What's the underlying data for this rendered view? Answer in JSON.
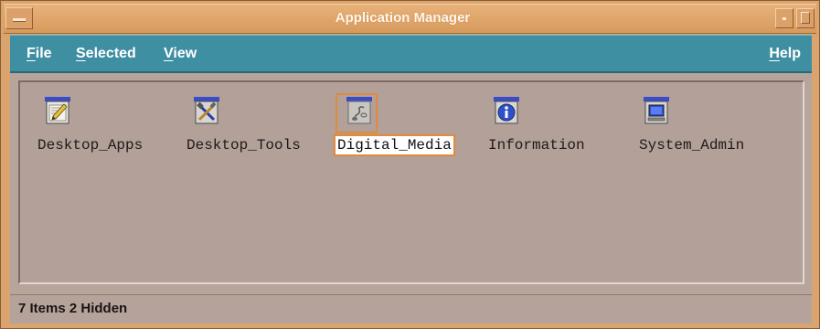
{
  "window": {
    "title": "Application Manager"
  },
  "menubar": {
    "file": {
      "mnemonic": "F",
      "rest": "ile"
    },
    "selected": {
      "mnemonic": "S",
      "rest": "elected"
    },
    "view": {
      "mnemonic": "V",
      "rest": "iew"
    },
    "help": {
      "mnemonic": "H",
      "rest": "elp"
    }
  },
  "icons": [
    {
      "label": "Desktop_Apps",
      "icon": "edit-pencil-icon",
      "selected": false
    },
    {
      "label": "Desktop_Tools",
      "icon": "tools-icon",
      "selected": false
    },
    {
      "label": "Digital_Media",
      "icon": "media-icon",
      "selected": true
    },
    {
      "label": "Information",
      "icon": "info-icon",
      "selected": false
    },
    {
      "label": "System_Admin",
      "icon": "monitor-icon",
      "selected": false
    }
  ],
  "status": {
    "text": "7 Items 2 Hidden"
  },
  "colors": {
    "frame": "#d9a46d",
    "menubar": "#3f8fa3",
    "panel": "#b2a099",
    "selection": "#e08a3a"
  }
}
